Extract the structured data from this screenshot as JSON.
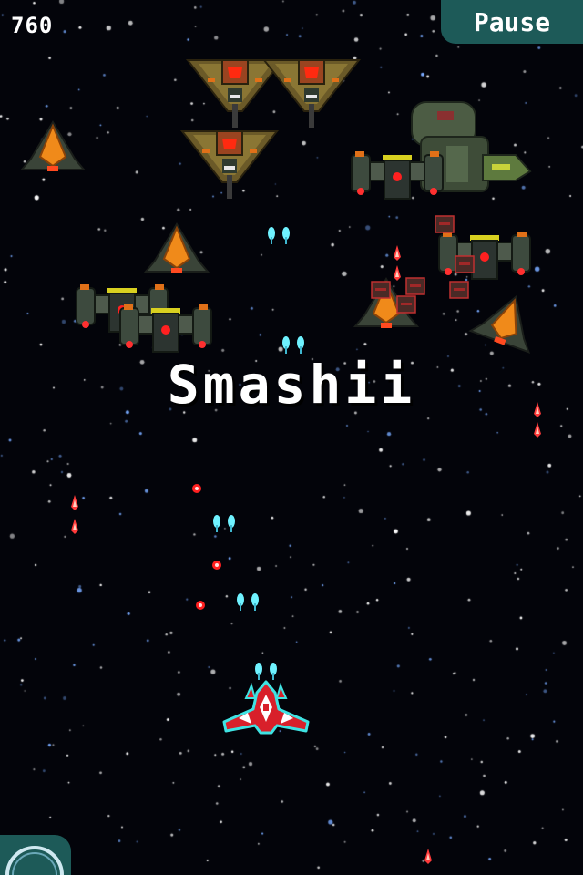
{
  "hud": {
    "score": "760",
    "pause_label": "Pause"
  },
  "combo": {
    "text": "Smashii"
  },
  "colors": {
    "space": "#03040a",
    "hud_teal": "#1d5a58",
    "player_red": "#d8202a",
    "player_outline": "#3fe3e3",
    "laser_cyan": "#6ff2ff",
    "enemy_bullet": "#ff3a3a",
    "bomber_olive": "#6b5a28",
    "scout_orange": "#f08a1a",
    "heavy_green": "#3d4a3e"
  },
  "icons": {
    "bomb": "bomb-icon",
    "player": "player-ship-icon"
  }
}
